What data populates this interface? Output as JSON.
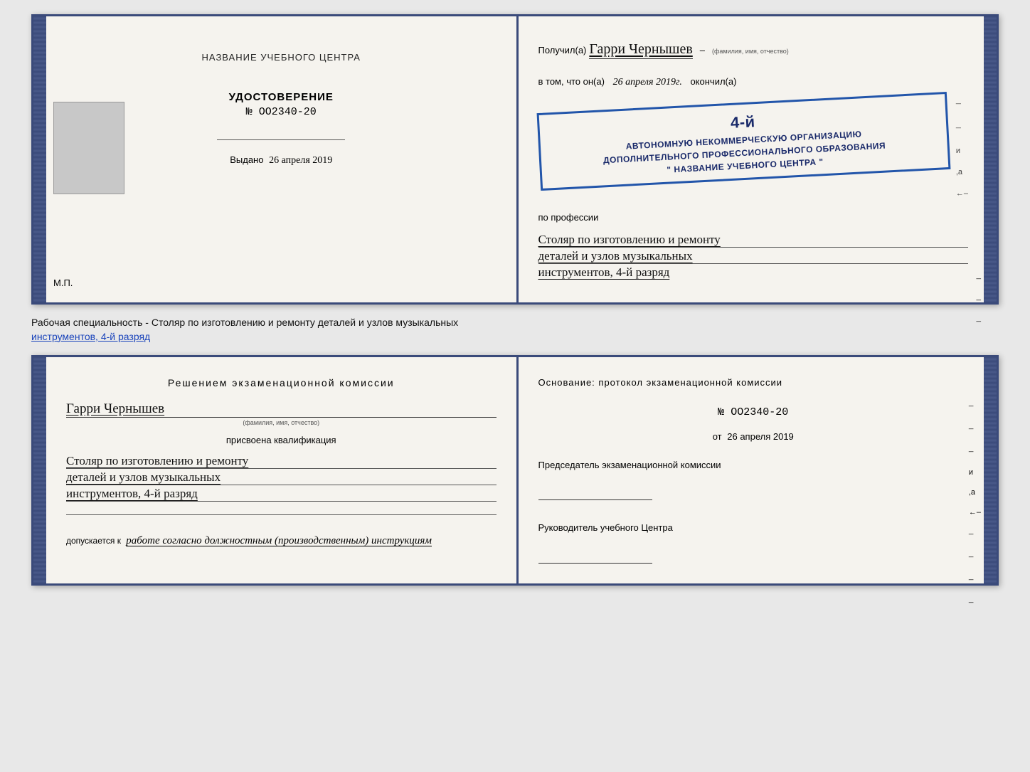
{
  "top_spread": {
    "left": {
      "org_name_label": "НАЗВАНИЕ УЧЕБНОГО ЦЕНТРА",
      "udostoverenie_title": "УДОСТОВЕРЕНИЕ",
      "number_label": "№ OO2340-20",
      "vydano_label": "Выдано",
      "vydano_date": "26 апреля 2019",
      "mp_label": "М.П."
    },
    "right": {
      "poluchil_prefix": "Получил(а)",
      "recipient_name": "Гарри Чернышев",
      "fio_hint": "(фамилия, имя, отчество)",
      "vtom_prefix": "в том, что он(а)",
      "vtom_date": "26 апреля 2019г.",
      "okonchil": "окончил(а)",
      "stamp_line1": "АВТОНОМНУЮ НЕКОММЕРЧЕСКУЮ ОРГАНИЗАЦИЮ",
      "stamp_line2": "ДОПОЛНИТЕЛЬНОГО ПРОФЕССИОНАЛЬНОГО ОБРАЗОВАНИЯ",
      "stamp_line3": "\" НАЗВАНИЕ УЧЕБНОГО ЦЕНТРА \"",
      "stamp_rank": "4-й",
      "po_professii": "по профессии",
      "profession_line1": "Столяр по изготовлению и ремонту",
      "profession_line2": "деталей и узлов музыкальных",
      "profession_line3": "инструментов, 4-й разряд"
    }
  },
  "caption": {
    "text1": "Рабочая специальность - Столяр по изготовлению и ремонту деталей и узлов музыкальных",
    "text2": "инструментов, 4-й разряд"
  },
  "bottom_spread": {
    "left": {
      "resheniyem_title": "Решением  экзаменационной  комиссии",
      "person_name": "Гарри Чернышев",
      "fio_hint": "(фамилия, имя, отчество)",
      "prisvoena_text": "присвоена квалификация",
      "qualification_line1": "Столяр по изготовлению и ремонту",
      "qualification_line2": "деталей и узлов музыкальных",
      "qualification_line3": "инструментов, 4-й разряд",
      "dopuskaetsya_label": "допускается к",
      "dopuskaetsya_value": "работе согласно должностным (производственным) инструкциям"
    },
    "right": {
      "osnovanie_text": "Основание: протокол экзаменационной  комиссии",
      "protocol_number": "№  OO2340-20",
      "ot_label": "от",
      "ot_date": "26 апреля 2019",
      "predsedatel_label": "Председатель экзаменационной комиссии",
      "rukovoditel_label": "Руководитель учебного Центра"
    }
  }
}
